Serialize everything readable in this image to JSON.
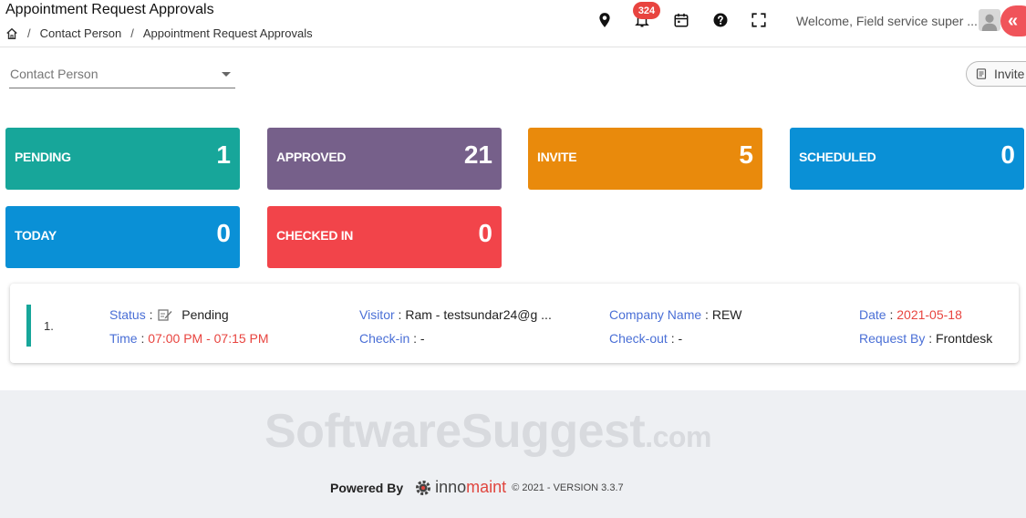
{
  "header": {
    "title": "Appointment Request Approvals",
    "breadcrumb": [
      "Contact Person",
      "Appointment Request Approvals"
    ],
    "notification_count": "324",
    "welcome": "Welcome, Field service super ..."
  },
  "icons": {
    "home": "home-icon",
    "location": "map-pin-icon",
    "notifications": "bell-icon",
    "calendar": "calendar-icon",
    "help": "question-circle-icon",
    "fullscreen": "expand-icon",
    "avatar": "user-icon",
    "collapse": "double-chevron-left-icon"
  },
  "filter": {
    "label": "Contact Person",
    "invite_label": "Invite"
  },
  "stats": [
    {
      "label": "PENDING",
      "value": "1",
      "color": "#17a69a"
    },
    {
      "label": "APPROVED",
      "value": "21",
      "color": "#76608a"
    },
    {
      "label": "INVITE",
      "value": "5",
      "color": "#e98a0c"
    },
    {
      "label": "SCHEDULED",
      "value": "0",
      "color": "#0a90d6"
    },
    {
      "label": "TODAY",
      "value": "0",
      "color": "#0a90d6"
    },
    {
      "label": "CHECKED IN",
      "value": "0",
      "color": "#f2444a"
    }
  ],
  "request": {
    "index": "1.",
    "status_key": "Status",
    "status": "Pending",
    "time_key": "Time",
    "time": "07:00 PM - 07:15 PM",
    "visitor_key": "Visitor",
    "visitor": "Ram - testsundar24@g ...",
    "checkin_key": "Check-in",
    "checkin": "-",
    "company_key": "Company Name",
    "company": "REW",
    "checkout_key": "Check-out",
    "checkout": "-",
    "date_key": "Date",
    "date": "2021-05-18",
    "requestby_key": "Request By",
    "requestby": "Frontdesk"
  },
  "footer": {
    "watermark": "SoftwareSuggest",
    "watermark_suffix": ".com",
    "powered_by": "Powered By",
    "brand_first": "inno",
    "brand_second": "maint",
    "copyright": "© 2021 - VERSION 3.3.7"
  }
}
